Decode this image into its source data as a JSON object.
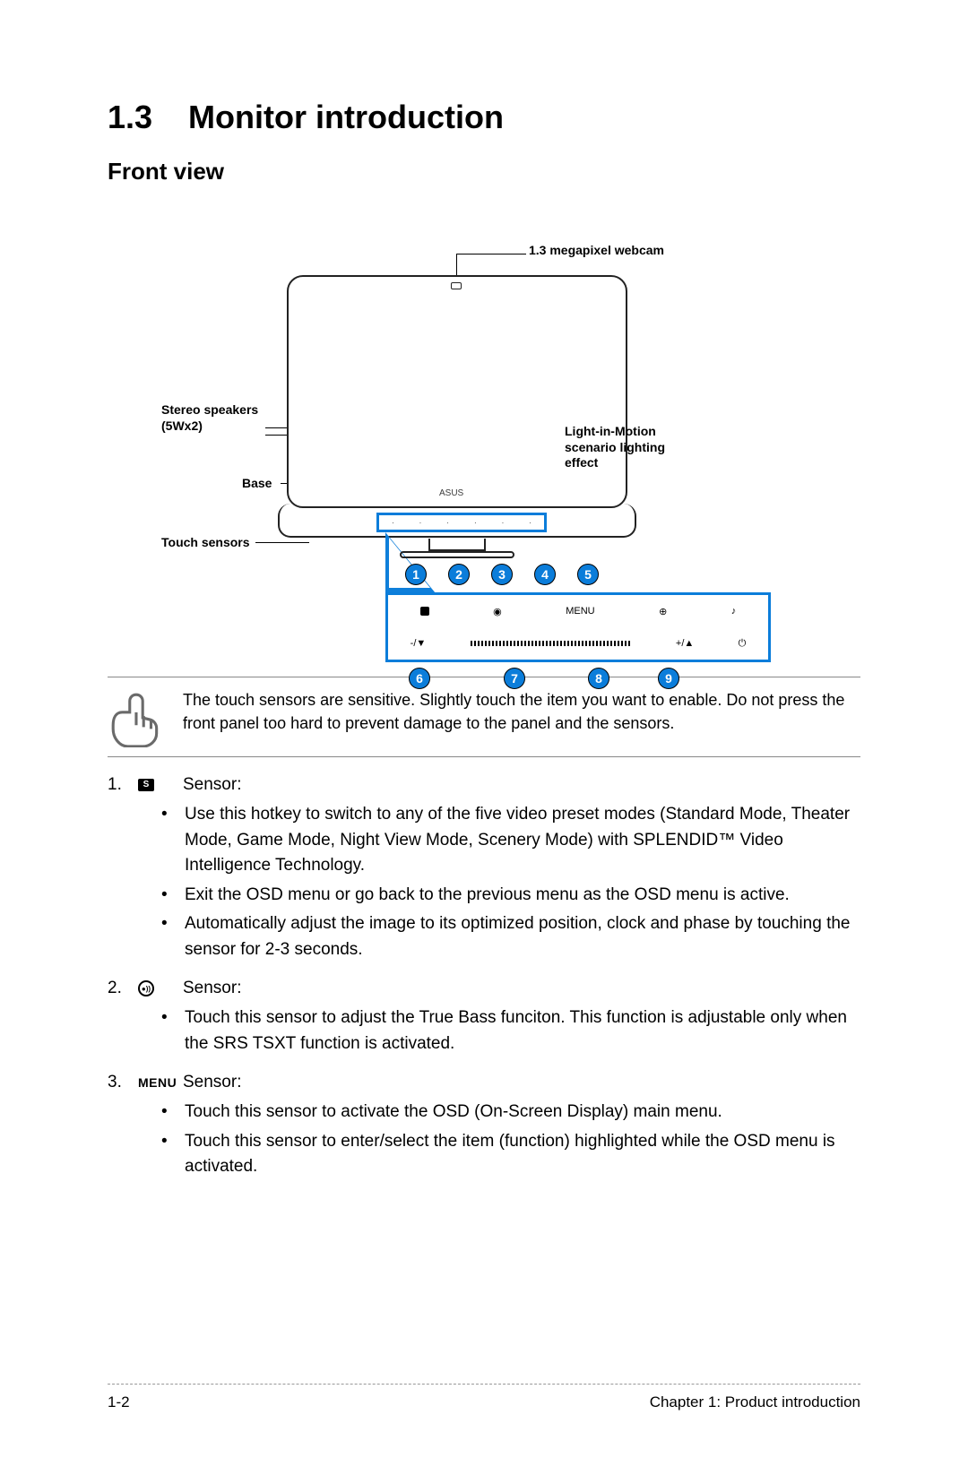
{
  "section": {
    "number": "1.3",
    "title": "Monitor introduction"
  },
  "subsection": "Front view",
  "callouts": {
    "webcam": "1.3 megapixel webcam",
    "speakers_line1": "Stereo speakers",
    "speakers_line2": "(5Wx2)",
    "lim_line1": "Light-in-Motion",
    "lim_line2": "scenario lighting",
    "lim_line3": "effect",
    "base": "Base",
    "touch_sensors": "Touch sensors",
    "asus_logo": "ASUS"
  },
  "bubbles_top": [
    "1",
    "2",
    "3",
    "4",
    "5"
  ],
  "bubbles_bottom": {
    "b6": "6",
    "b7": "7",
    "b8": "8",
    "b9": "9"
  },
  "zoom_icons": {
    "s": "S",
    "menu": "MENU",
    "minus": "-/▼",
    "plus": "+/▲",
    "power": "⏻",
    "note": "♪"
  },
  "note_text": "The touch sensors are sensitive. Slightly touch the item you want to enable. Do not press the front panel too hard to prevent damage to the panel and the sensors.",
  "sensors": [
    {
      "num": "1.",
      "icon_kind": "s",
      "icon_text": "S",
      "label": "Sensor:",
      "bullets": [
        "Use this hotkey to switch to any of the five video preset modes (Standard Mode, Theater Mode, Game Mode, Night View Mode, Scenery Mode) with SPLENDID™ Video Intelligence Technology.",
        "Exit the OSD menu or go back to the previous menu as the OSD menu is active.",
        "Automatically adjust the image to its optimized position, clock and phase by touching the sensor for 2-3 seconds."
      ]
    },
    {
      "num": "2.",
      "icon_kind": "circ",
      "icon_text": "●))",
      "label": "Sensor:",
      "bullets": [
        "Touch this sensor to adjust the True Bass funciton. This function is adjustable only when the SRS TSXT function is activated."
      ]
    },
    {
      "num": "3.",
      "icon_kind": "menu",
      "icon_text": "MENU",
      "label": "Sensor:",
      "bullets": [
        "Touch this sensor to activate the OSD (On-Screen Display) main menu.",
        "Touch this sensor to enter/select the item (function) highlighted while the OSD menu is activated."
      ]
    }
  ],
  "footer": {
    "page": "1-2",
    "chapter": "Chapter 1: Product introduction"
  }
}
